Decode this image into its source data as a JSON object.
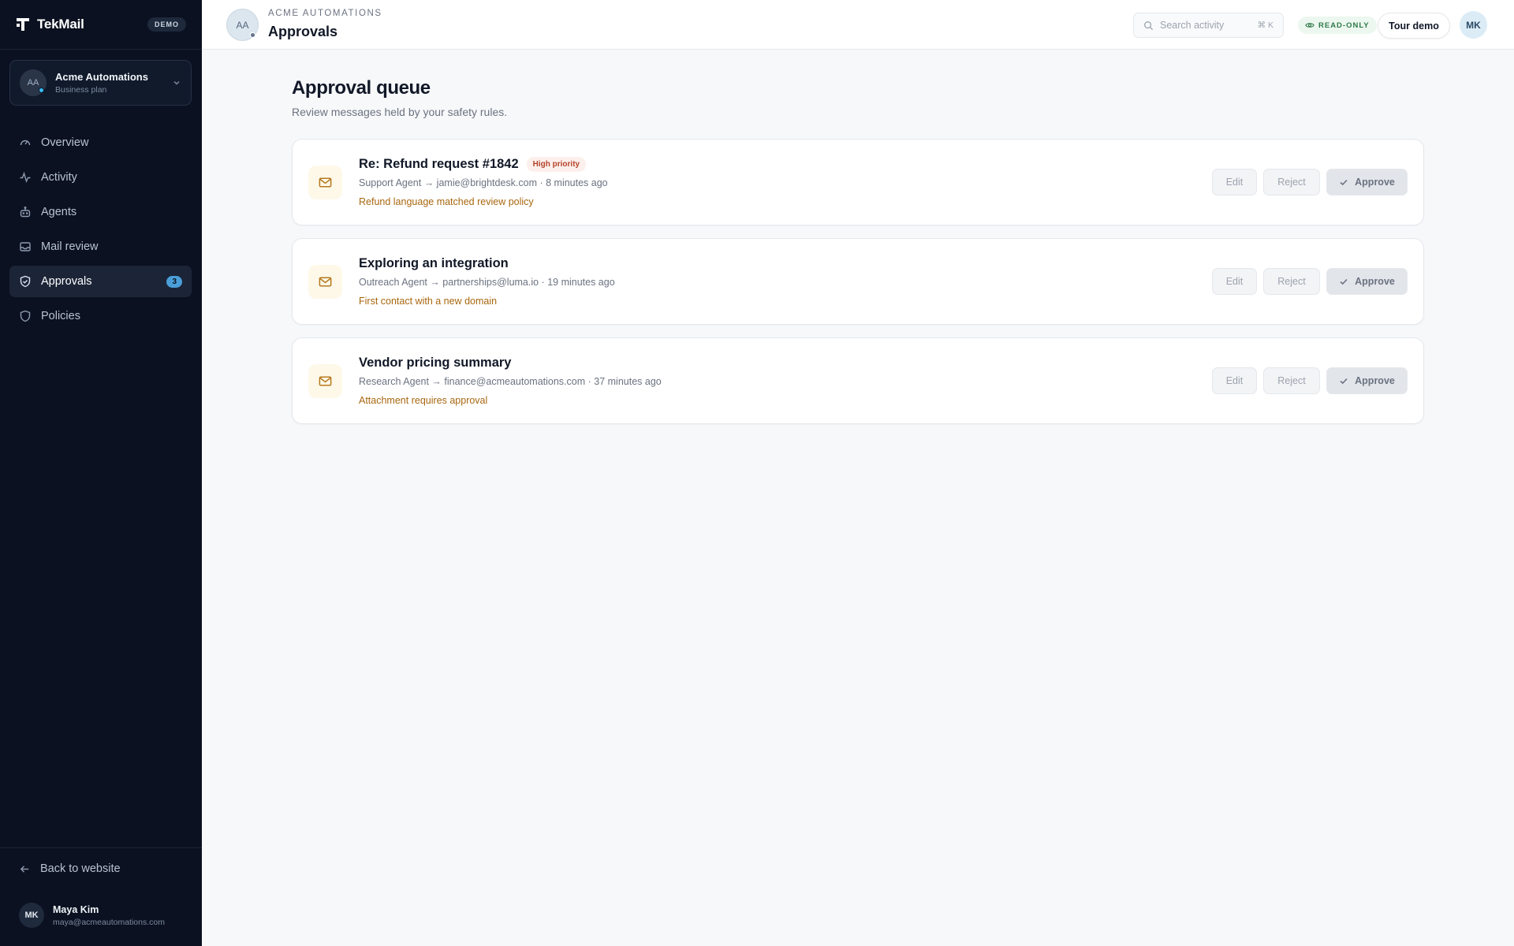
{
  "brand": {
    "name": "TekMail",
    "badge": "DEMO"
  },
  "workspace": {
    "initials": "AA",
    "name": "Acme Automations",
    "plan": "Business plan"
  },
  "nav": [
    {
      "label": "Overview",
      "icon": "gauge-icon"
    },
    {
      "label": "Activity",
      "icon": "activity-icon"
    },
    {
      "label": "Agents",
      "icon": "bot-icon"
    },
    {
      "label": "Mail review",
      "icon": "inbox-icon"
    },
    {
      "label": "Approvals",
      "icon": "shield-check-icon",
      "active": true,
      "count": "3"
    },
    {
      "label": "Policies",
      "icon": "shield-icon"
    }
  ],
  "footer": {
    "back_label": "Back to website",
    "user": {
      "initials": "MK",
      "name": "Maya Kim",
      "email": "maya@acmeautomations.com"
    }
  },
  "topbar": {
    "org_initials": "AA",
    "org_label": "ACME AUTOMATIONS",
    "title": "Approvals",
    "search_placeholder": "Search activity",
    "search_shortcut": "⌘ K",
    "readonly_label": "READ-ONLY",
    "tour_label": "Tour demo",
    "me_initials": "MK"
  },
  "main": {
    "title": "Approval queue",
    "subtitle": "Review messages held by your safety rules.",
    "actions": {
      "edit": "Edit",
      "reject": "Reject",
      "approve": "Approve"
    },
    "items": [
      {
        "title": "Re: Refund request #1842",
        "priority": "High priority",
        "meta": "Support Agent → jamie@brightdesk.com · 8 minutes ago",
        "reason": "Refund language matched review policy"
      },
      {
        "title": "Exploring an integration",
        "priority": "",
        "meta": "Outreach Agent → partnerships@luma.io · 19 minutes ago",
        "reason": "First contact with a new domain"
      },
      {
        "title": "Vendor pricing summary",
        "priority": "",
        "meta": "Research Agent → finance@acmeautomations.com · 37 minutes ago",
        "reason": "Attachment requires approval"
      }
    ]
  },
  "colors": {
    "sidebar_bg": "#0b1120",
    "accent_badge": "#4a9fd8",
    "warning_text": "#a8670f",
    "priority_text": "#b4432a",
    "readonly_text": "#2f7a48"
  }
}
